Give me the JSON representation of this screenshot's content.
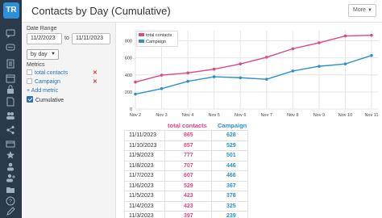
{
  "sidebar": {
    "logo_text": "TR",
    "icons": [
      "chat-icon",
      "message-icon",
      "list-icon",
      "calendar-icon",
      "lock-icon",
      "doc-icon",
      "people-icon",
      "share-icon",
      "card-icon",
      "star-icon",
      "user-icon",
      "user-add-icon",
      "folder-icon",
      "help-icon",
      "edit-icon",
      "download-icon"
    ]
  },
  "header": {
    "title": "Contacts by Day (Cumulative)",
    "more_label": "More"
  },
  "panel": {
    "date_range_label": "Date Range",
    "start_date": "11/2/2023",
    "to_label": "to",
    "end_date": "11/11/2023",
    "group_by": "by day",
    "metrics_label": "Metrics",
    "metrics": [
      {
        "label": "total contacts"
      },
      {
        "label": "Campaign"
      }
    ],
    "add_metric_label": "+ Add metric",
    "cumulative_label": "Cumulative"
  },
  "colors": {
    "total_contacts": "#e0468a",
    "campaign": "#2e8fd0",
    "sidebar_bg": "#2b3a4a"
  },
  "chart_data": {
    "type": "line",
    "categories": [
      "Nov 2",
      "Nov 3",
      "Nov 4",
      "Nov 5",
      "Nov 6",
      "Nov 7",
      "Nov 8",
      "Nov 9",
      "Nov 10",
      "Nov 11"
    ],
    "series": [
      {
        "name": "total contacts",
        "values": [
          316,
          397,
          423,
          467,
          529,
          607,
          707,
          777,
          857,
          865
        ]
      },
      {
        "name": "Campaign",
        "values": [
          175,
          239,
          325,
          378,
          367,
          349,
          446,
          501,
          529,
          628
        ]
      }
    ],
    "ylim": [
      0,
      900
    ],
    "yticks": [
      0,
      200,
      400,
      600,
      800
    ],
    "grid": true,
    "legend": "top-left"
  },
  "table": {
    "headers": [
      "",
      "total contacts",
      "Campaign"
    ],
    "rows": [
      {
        "date": "11/11/2023",
        "total": "865",
        "campaign": "628"
      },
      {
        "date": "11/10/2023",
        "total": "857",
        "campaign": "529"
      },
      {
        "date": "11/9/2023",
        "total": "777",
        "campaign": "501"
      },
      {
        "date": "11/8/2023",
        "total": "707",
        "campaign": "446"
      },
      {
        "date": "11/7/2023",
        "total": "607",
        "campaign": "466"
      },
      {
        "date": "11/6/2023",
        "total": "529",
        "campaign": "367"
      },
      {
        "date": "11/5/2023",
        "total": "423",
        "campaign": "378"
      },
      {
        "date": "11/4/2023",
        "total": "423",
        "campaign": "325"
      },
      {
        "date": "11/3/2023",
        "total": "397",
        "campaign": "239"
      }
    ]
  }
}
